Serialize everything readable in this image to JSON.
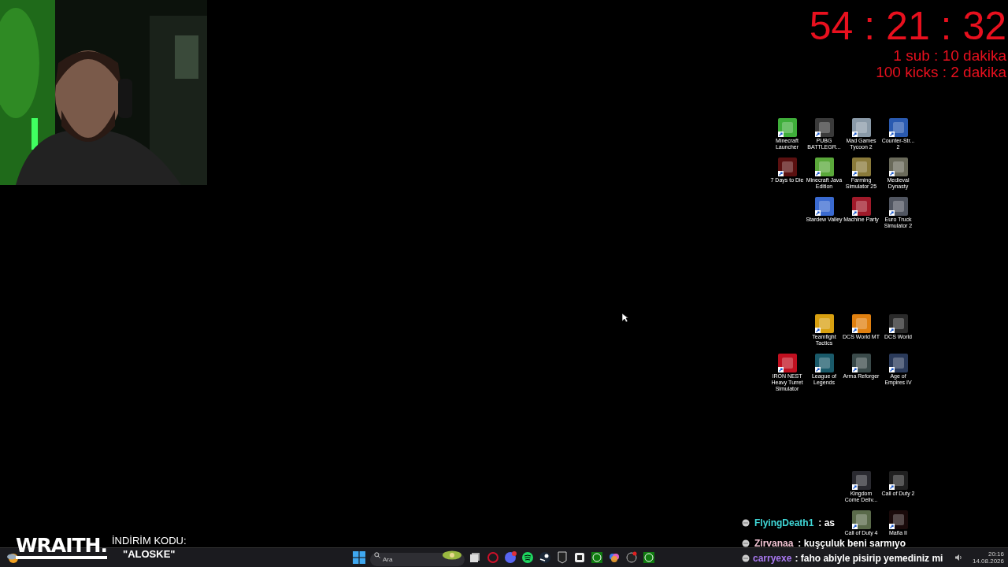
{
  "timer": {
    "time": "54 : 21 : 32",
    "rules": [
      "1 sub : 10 dakika",
      "100 kicks : 2 dakika"
    ]
  },
  "desktop_icon_groups": [
    {
      "rows": [
        [
          {
            "label": "Minecraft Launcher",
            "color": "#3fae3a"
          },
          {
            "label": "PUBG BATTLEGR...",
            "color": "#3a3a3a"
          },
          {
            "label": "Mad Games Tycoon 2",
            "color": "#8a9aa8"
          },
          {
            "label": "Counter-Str... 2",
            "color": "#2a5ab0"
          }
        ],
        [
          {
            "label": "7 Days to Die",
            "color": "#5a1010"
          },
          {
            "label": "Minecraft Java Edition",
            "color": "#5aa83a"
          },
          {
            "label": "Farming Simulator 25",
            "color": "#8a7a3a"
          },
          {
            "label": "Medieval Dynasty",
            "color": "#6a6a5a"
          }
        ],
        [
          "",
          {
            "label": "Stardew Valley",
            "color": "#3a6ad0"
          },
          {
            "label": "Machine Party",
            "color": "#a01a2a"
          },
          {
            "label": "Euro Truck Simulator 2",
            "color": "#505560"
          }
        ]
      ]
    },
    {
      "rows": [
        [
          "",
          {
            "label": "Teamfight Tactics",
            "color": "#d8a010"
          },
          {
            "label": "DCS World MT",
            "color": "#e08010"
          },
          {
            "label": "DCS World",
            "color": "#2a2a2a"
          }
        ],
        [
          {
            "label": "IRON NEST Heavy Turret Simulator",
            "color": "#c01020"
          },
          {
            "label": "League of Legends",
            "color": "#1a5a6a"
          },
          {
            "label": "Arma Reforger",
            "color": "#3a4a4a"
          },
          {
            "label": "Age of Empires IV",
            "color": "#2a3a5a"
          }
        ]
      ]
    },
    {
      "rows": [
        [
          "",
          "",
          {
            "label": "Kingdom Come Deliv...",
            "color": "#2a2a30"
          },
          {
            "label": "Call of Duty 2",
            "color": "#202020"
          }
        ],
        [
          "",
          "",
          {
            "label": "Call of Duty 4",
            "color": "#5a6a4a"
          },
          {
            "label": "Mafia II",
            "color": "#1a0a0a"
          }
        ]
      ]
    }
  ],
  "chat": [
    {
      "user": "FlyingDeath1",
      "color": "#40d8d8",
      "message": ": as"
    },
    {
      "user": "Zirvanaa",
      "color": "#f2c4d4",
      "message": ": kuşçuluk beni sarmıyo"
    },
    {
      "user": "carryexe",
      "color": "#a878f0",
      "message": ": faho abiyle pisirip yemediniz mi"
    }
  ],
  "sponsor": {
    "brand": "WRAITH.",
    "caption": "İNDİRİM KODU:",
    "code": "\"ALOSKE\""
  },
  "taskbar": {
    "search": {
      "placeholder": "Ara"
    },
    "clock": {
      "time": "20:16",
      "date": "14.08.2026"
    }
  }
}
